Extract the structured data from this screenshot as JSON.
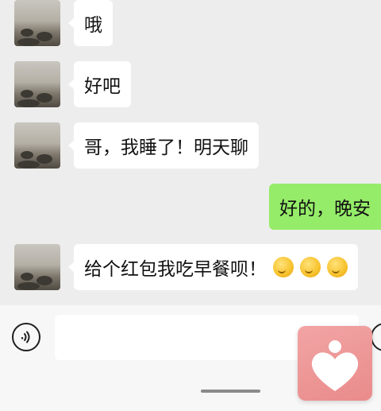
{
  "messages": [
    {
      "direction": "in",
      "text": "哦"
    },
    {
      "direction": "in",
      "text": "好吧"
    },
    {
      "direction": "in",
      "text": "哥，我睡了！明天聊"
    },
    {
      "direction": "out",
      "text": "好的，晚安"
    },
    {
      "direction": "in",
      "text": "给个红包我吃早餐呗！",
      "emoji_count": 3,
      "emoji_name": "thinking-face-emoji"
    }
  ],
  "input_bar": {
    "text_value": "",
    "voice_icon": "voice-icon",
    "emoji_icon": "emoji-icon"
  },
  "floating_app": {
    "icon": "heart-app-icon"
  },
  "colors": {
    "background": "#ededed",
    "incoming_bubble": "#ffffff",
    "outgoing_bubble": "#95ec69",
    "input_bar": "#f7f7f7",
    "floating_app": "#e98b8b"
  }
}
